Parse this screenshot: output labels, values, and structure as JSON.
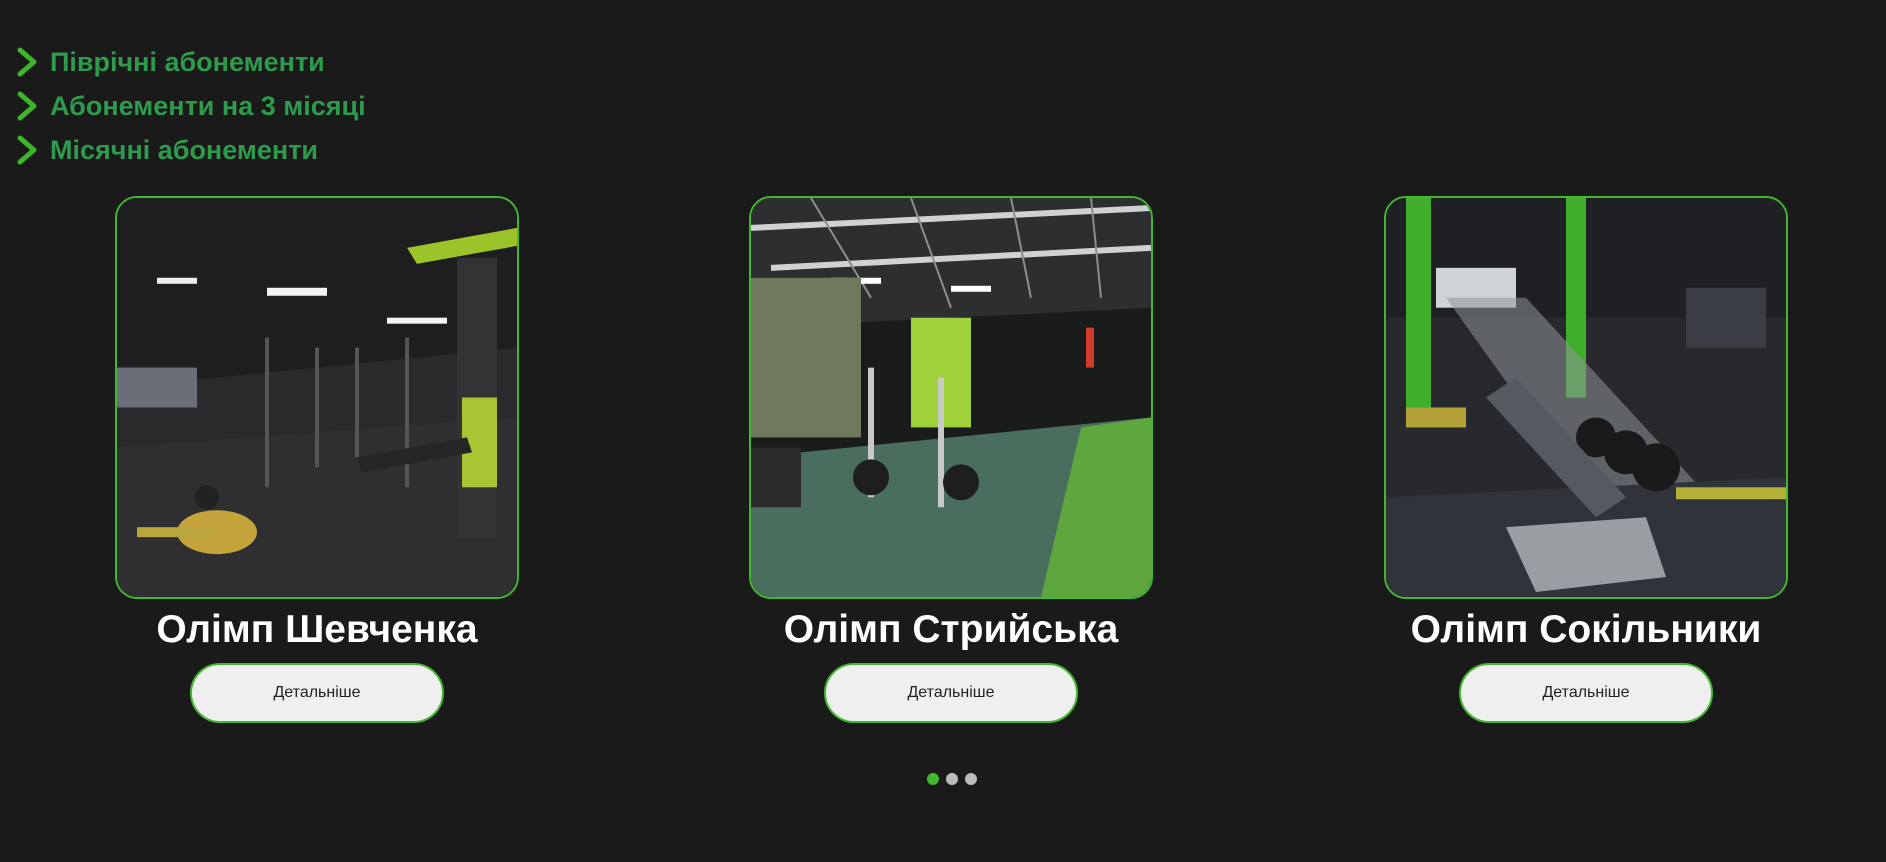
{
  "plans": [
    {
      "label": "Піврічні абонементи",
      "icon": "chevron-right-icon"
    },
    {
      "label": "Абонементи на 3 місяці",
      "icon": "chevron-right-icon"
    },
    {
      "label": "Місячні абонементи",
      "icon": "chevron-right-icon"
    }
  ],
  "gyms": [
    {
      "name": "Олімп Шевченка",
      "button": "Детальніше"
    },
    {
      "name": "Олімп Стрийська",
      "button": "Детальніше"
    },
    {
      "name": "Олімп Сокільники",
      "button": "Детальніше"
    }
  ],
  "pagination": {
    "count": 3,
    "active": 1
  },
  "colors": {
    "background": "#1a1a1a",
    "accent": "#43b72f",
    "plan_text": "#2e9a4c",
    "button_bg": "#efefef",
    "dot_inactive": "#bbbbbb"
  }
}
